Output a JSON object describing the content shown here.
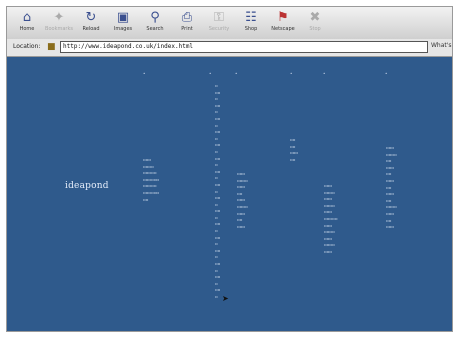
{
  "toolbar": {
    "buttons": [
      {
        "label": "Home",
        "icon": "house-icon",
        "enabled": true
      },
      {
        "label": "Bookmarks",
        "icon": "bookmark-icon",
        "enabled": false
      },
      {
        "label": "Reload",
        "icon": "reload-icon",
        "enabled": true
      },
      {
        "label": "Images",
        "icon": "image-icon",
        "enabled": true
      },
      {
        "label": "Search",
        "icon": "search-icon",
        "enabled": true
      },
      {
        "label": "Print",
        "icon": "print-icon",
        "enabled": true
      },
      {
        "label": "Security",
        "icon": "security-icon",
        "enabled": false
      },
      {
        "label": "Shop",
        "icon": "shop-icon",
        "enabled": true
      },
      {
        "label": "Netscape",
        "icon": "netscape-icon",
        "enabled": true
      },
      {
        "label": "Stop",
        "icon": "stop-icon",
        "enabled": false
      }
    ]
  },
  "location": {
    "label": "Location:",
    "url": "http://www.ideapond.co.uk/index.html",
    "end_label": "What's"
  },
  "page": {
    "logo_text": "ideapond"
  },
  "colors": {
    "page_background": "#2f5a8c"
  }
}
